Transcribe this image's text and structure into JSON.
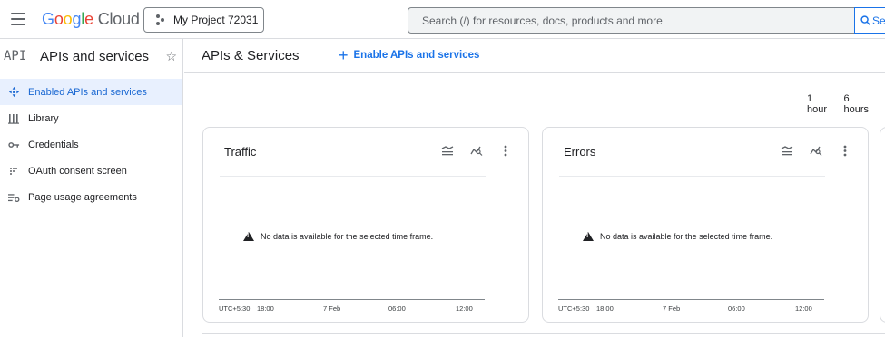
{
  "topbar": {
    "logo_google": [
      "G",
      "o",
      "o",
      "g",
      "l",
      "e"
    ],
    "logo_cloud": "Cloud",
    "project": "My Project 72031",
    "search_placeholder": "Search (/) for resources, docs, products and more",
    "search_button": "Se"
  },
  "sidebar": {
    "api_logo": "API",
    "title": "APIs and services",
    "items": [
      {
        "label": "Enabled APIs and services",
        "icon": "diamond-nav-icon",
        "active": true
      },
      {
        "label": "Library",
        "icon": "library-icon",
        "active": false
      },
      {
        "label": "Credentials",
        "icon": "key-icon",
        "active": false
      },
      {
        "label": "OAuth consent screen",
        "icon": "consent-icon",
        "active": false
      },
      {
        "label": "Page usage agreements",
        "icon": "settings-list-icon",
        "active": false
      }
    ]
  },
  "main": {
    "title": "APIs & Services",
    "enable_link": "Enable APIs and services",
    "time_options": [
      "1 hour",
      "6 hours"
    ]
  },
  "cards": [
    {
      "title": "Traffic",
      "no_data": "No data is available for the selected time frame.",
      "ticks": [
        "UTC+5:30",
        "18:00",
        "7 Feb",
        "06:00",
        "12:00"
      ]
    },
    {
      "title": "Errors",
      "no_data": "No data is available for the selected time frame.",
      "ticks": [
        "UTC+5:30",
        "18:00",
        "7 Feb",
        "06:00",
        "12:00"
      ]
    }
  ],
  "colors": {
    "accent": "#1a73e8",
    "active_bg": "#e8f0fe",
    "border": "#dadce0"
  }
}
